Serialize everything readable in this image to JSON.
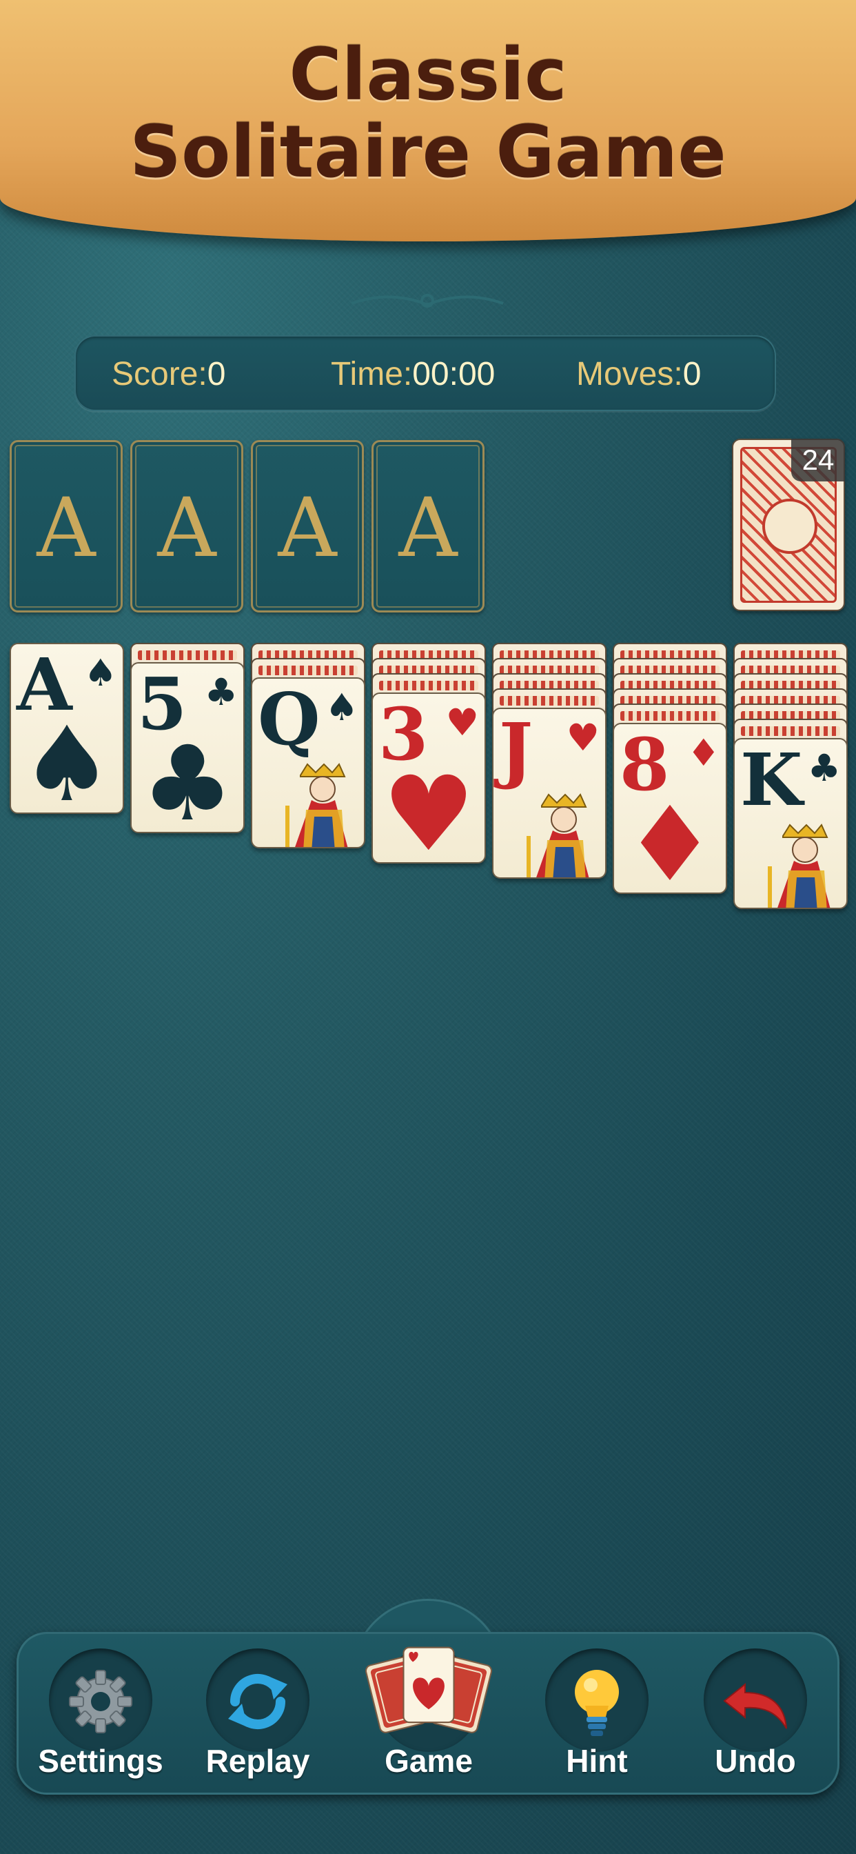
{
  "banner": {
    "title": "Classic Solitaire Game"
  },
  "stats": {
    "score_label": "Score:",
    "score_value": "0",
    "time_label": "Time:",
    "time_value": "00:00",
    "moves_label": "Moves:",
    "moves_value": "0"
  },
  "foundations": [
    "A",
    "A",
    "A",
    "A"
  ],
  "stock": {
    "count": "24"
  },
  "tableau": [
    {
      "hidden": 0,
      "rank": "A",
      "suit": "♠",
      "color": "black"
    },
    {
      "hidden": 1,
      "rank": "5",
      "suit": "♣",
      "color": "black"
    },
    {
      "hidden": 2,
      "rank": "Q",
      "suit": "♠",
      "color": "black"
    },
    {
      "hidden": 3,
      "rank": "3",
      "suit": "♥",
      "color": "red"
    },
    {
      "hidden": 4,
      "rank": "J",
      "suit": "♥",
      "color": "red"
    },
    {
      "hidden": 5,
      "rank": "8",
      "suit": "♦",
      "color": "red"
    },
    {
      "hidden": 6,
      "rank": "K",
      "suit": "♣",
      "color": "black"
    }
  ],
  "toolbar": {
    "settings_label": "Settings",
    "replay_label": "Replay",
    "game_label": "Game",
    "hint_label": "Hint",
    "undo_label": "Undo"
  },
  "icons": {
    "settings": "gear-icon",
    "replay": "refresh-icon",
    "game": "cards-icon",
    "hint": "lightbulb-icon",
    "undo": "undo-arrow-icon"
  },
  "colors": {
    "banner": "#e4a65a",
    "title": "#4b1e0e",
    "felt": "#1d4f5a",
    "stat_text": "#f3dc8a",
    "red_suit": "#c9282b",
    "black_suit": "#13303a"
  }
}
